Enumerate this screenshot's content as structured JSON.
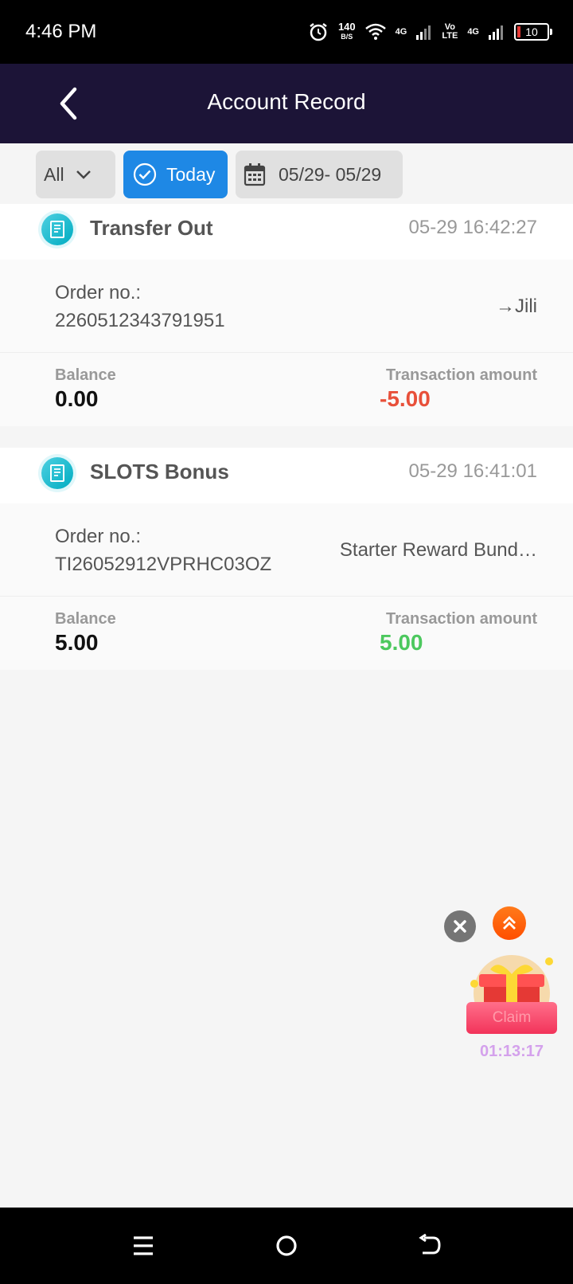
{
  "status_bar": {
    "time": "4:46 PM",
    "net_speed": "140",
    "net_unit": "B/S",
    "signal1": "4G",
    "volte_top": "Vo",
    "volte_bottom": "LTE",
    "signal2": "4G",
    "battery": "10"
  },
  "header": {
    "title": "Account Record"
  },
  "filters": {
    "type_selected": "All",
    "today_label": "Today",
    "date_range": "05/29- 05/29"
  },
  "records": [
    {
      "title": "Transfer Out",
      "timestamp": "05-29 16:42:27",
      "order_label": "Order no.:",
      "order_no": "2260512343791951",
      "destination": "→Jili",
      "balance_label": "Balance",
      "balance": "0.00",
      "amount_label": "Transaction amount",
      "amount": "-5.00"
    },
    {
      "title": "SLOTS Bonus",
      "timestamp": "05-29 16:41:01",
      "order_label": "Order no.:",
      "order_no": "TI26052912VPRHC03OZ",
      "destination": "Starter Reward Bund…",
      "balance_label": "Balance",
      "balance": "5.00",
      "amount_label": "Transaction amount",
      "amount": "5.00"
    }
  ],
  "floating": {
    "claim_label": "Claim",
    "countdown": "01:13:17"
  },
  "colors": {
    "header_bg": "#1c1437",
    "accent_blue": "#1e88e5",
    "negative": "#e8503a",
    "positive": "#4cc85e"
  }
}
